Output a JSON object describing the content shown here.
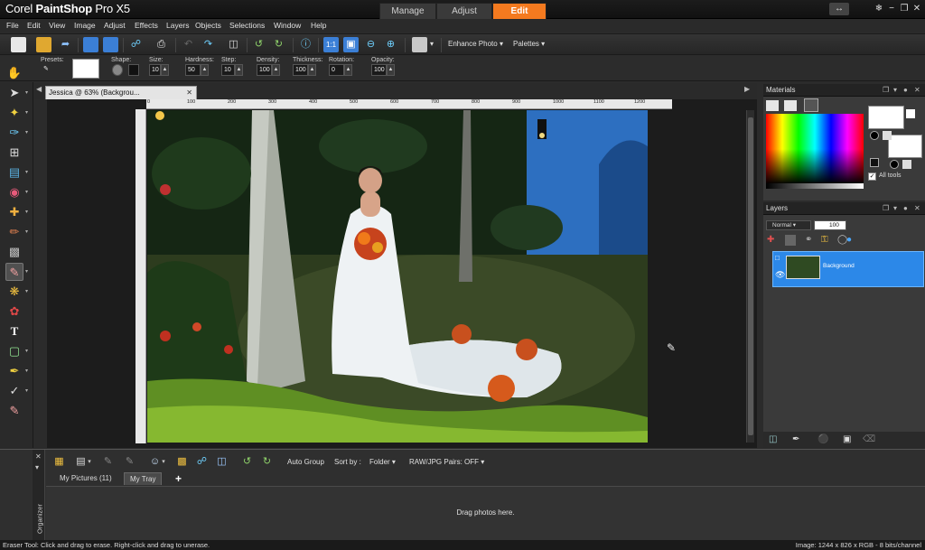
{
  "app": {
    "title_prefix": "Corel",
    "title_bold": "PaintShop",
    "title_suffix": "Pro X5",
    "modes": [
      "Manage",
      "Adjust",
      "Edit"
    ],
    "active_mode": "Edit"
  },
  "menu": [
    "File",
    "Edit",
    "View",
    "Image",
    "Adjust",
    "Effects",
    "Layers",
    "Objects",
    "Selections",
    "Window",
    "Help"
  ],
  "toolbar": {
    "enhance_photo": "Enhance Photo",
    "palettes": "Palettes"
  },
  "tool_options": {
    "presets_label": "Presets:",
    "shape_label": "Shape:",
    "size_label": "Size:",
    "size_value": "10",
    "hardness_label": "Hardness:",
    "hardness_value": "50",
    "step_label": "Step:",
    "step_value": "10",
    "density_label": "Density:",
    "density_value": "100",
    "thickness_label": "Thickness:",
    "thickness_value": "100",
    "rotation_label": "Rotation:",
    "rotation_value": "0",
    "opacity_label": "Opacity:",
    "opacity_value": "100"
  },
  "document": {
    "tab_title": "Jessica @  63% (Backgrou...",
    "ruler_ticks": [
      "0",
      "100",
      "200",
      "300",
      "400",
      "500",
      "600",
      "700",
      "800",
      "900",
      "1000",
      "1100",
      "1200"
    ]
  },
  "materials": {
    "title": "Materials",
    "all_tools_label": "All tools",
    "all_tools_checked": true
  },
  "layers": {
    "title": "Layers",
    "blend_mode": "Normal",
    "opacity": "100",
    "layer_name": "Background"
  },
  "organizer": {
    "side_label": "Organizer",
    "auto_group": "Auto Group",
    "sort_by_label": "Sort by :",
    "sort_by_value": "Folder",
    "raw_jpg": "RAW/JPG Pairs: OFF",
    "tabs": [
      "My Pictures (11)",
      "My Tray"
    ],
    "active_tab": "My Tray",
    "add_tab": "+",
    "drop_text": "Drag photos here."
  },
  "status": {
    "left": "Eraser Tool: Click and drag to erase. Right-click and drag to unerase.",
    "right": "Image:  1244 x 826 x RGB - 8 bits/channel"
  },
  "colors": {
    "accent": "#f47a1f",
    "selection": "#2c88e8"
  }
}
